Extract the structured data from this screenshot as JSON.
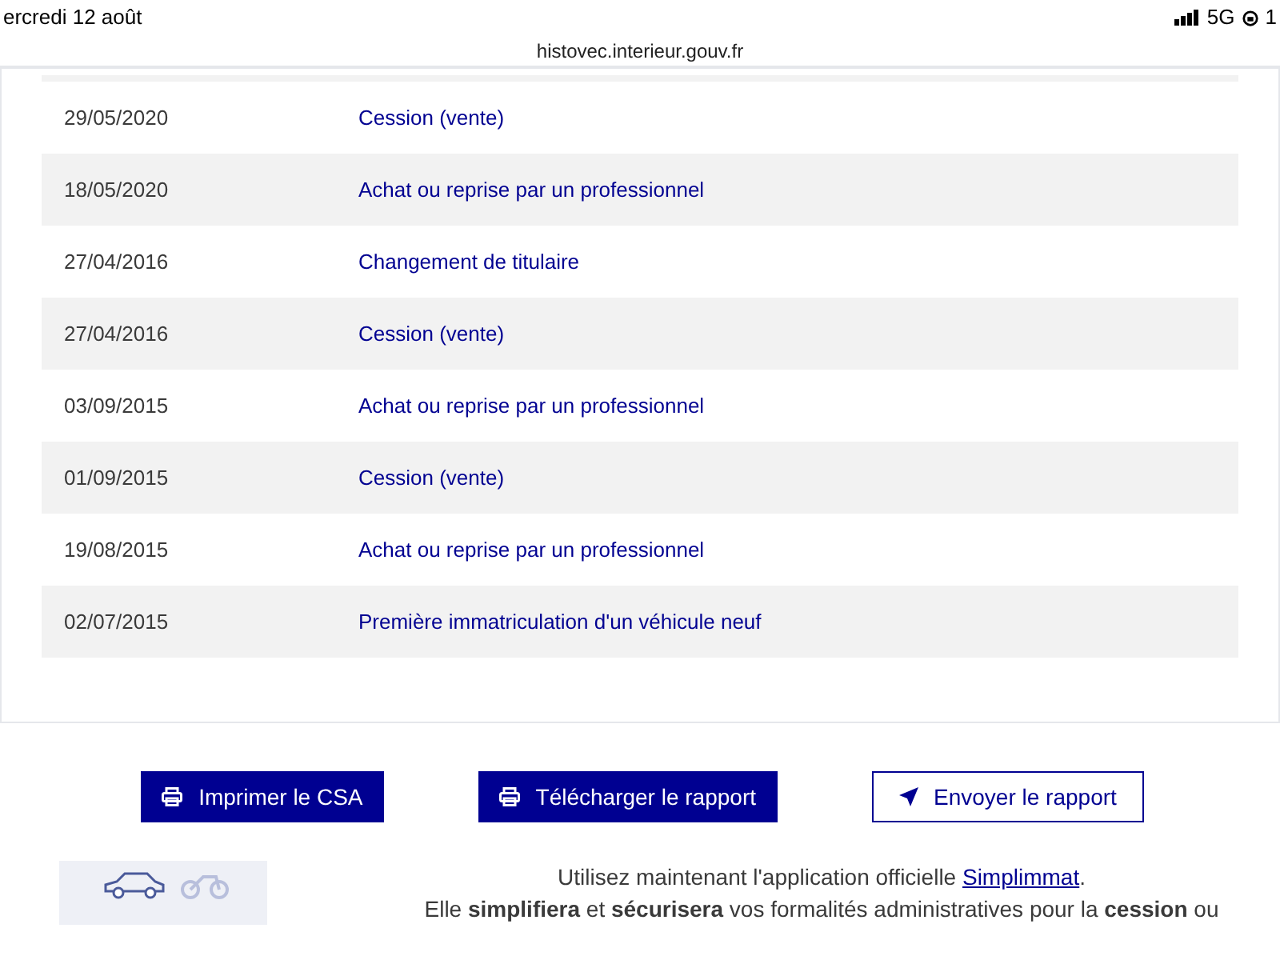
{
  "status_bar": {
    "date": "ercredi 12 août",
    "network": "5G",
    "battery": "1"
  },
  "address_bar": {
    "url": "histovec.interieur.gouv.fr"
  },
  "history_table": {
    "rows": [
      {
        "date": "29/05/2020",
        "event": "Cession (vente)"
      },
      {
        "date": "18/05/2020",
        "event": "Achat ou reprise par un professionnel"
      },
      {
        "date": "27/04/2016",
        "event": "Changement de titulaire"
      },
      {
        "date": "27/04/2016",
        "event": "Cession (vente)"
      },
      {
        "date": "03/09/2015",
        "event": "Achat ou reprise par un professionnel"
      },
      {
        "date": "01/09/2015",
        "event": "Cession (vente)"
      },
      {
        "date": "19/08/2015",
        "event": "Achat ou reprise par un professionnel"
      },
      {
        "date": "02/07/2015",
        "event": "Première immatriculation d'un véhicule neuf"
      }
    ]
  },
  "actions": [
    {
      "label": "Imprimer le CSA",
      "kind": "print"
    },
    {
      "label": "Télécharger le rapport",
      "kind": "print"
    },
    {
      "label": "Envoyer le rapport",
      "kind": "send"
    }
  ],
  "promo": {
    "intro": "Utilisez maintenant l'application officielle",
    "link": "Simplimmat",
    "after": ".",
    "line_2": "Elle **simplifiera** et **sécurisera** vos formalités administratives pour la **cession** ou"
  }
}
